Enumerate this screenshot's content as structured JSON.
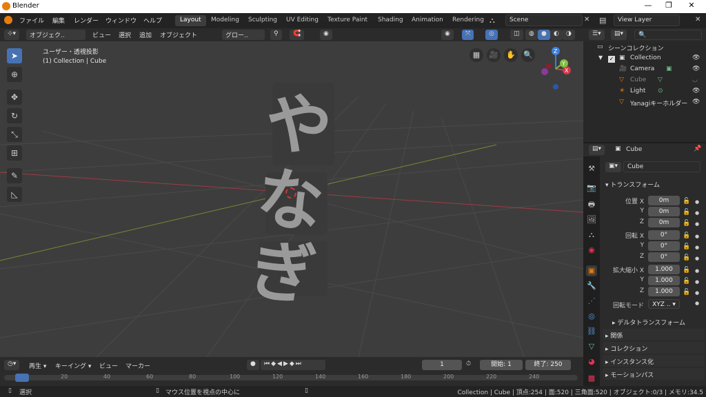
{
  "window": {
    "title": "Blender"
  },
  "menu": [
    "ファイル",
    "編集",
    "レンダー",
    "ウィンドウ",
    "ヘルプ"
  ],
  "workspaces": [
    "Layout",
    "Modeling",
    "Sculpting",
    "UV Editing",
    "Texture Paint",
    "Shading",
    "Animation",
    "Rendering"
  ],
  "scene": "Scene",
  "view_layer": "View Layer",
  "viewport_header": {
    "mode": "オブジェク..",
    "view": "ビュー",
    "select": "選択",
    "add": "追加",
    "object": "オブジェクト",
    "orientation": "グロー.."
  },
  "viewport": {
    "view_name": "ユーザー・透視投影",
    "collection_info": "(1) Collection | Cube",
    "mesh_text": "やなぎ",
    "gizmo": {
      "x": "X",
      "y": "Y",
      "z": "Z"
    }
  },
  "outliner": {
    "scene_collection": "シーンコレクション",
    "items": [
      {
        "name": "Collection"
      },
      {
        "name": "Camera"
      },
      {
        "name": "Cube"
      },
      {
        "name": "Light"
      },
      {
        "name": "Yanagiキーホルダー"
      }
    ]
  },
  "properties": {
    "object_name": "Cube",
    "datablock": "Cube",
    "transform": "トランスフォーム",
    "location_label": "位置",
    "rotation_label": "回転",
    "scale_label": "拡大縮小",
    "axes": [
      "X",
      "Y",
      "Z"
    ],
    "location": [
      "0m",
      "0m",
      "0m"
    ],
    "rotation": [
      "0°",
      "0°",
      "0°"
    ],
    "scale": [
      "1.000",
      "1.000",
      "1.000"
    ],
    "rotation_mode_label": "回転モード",
    "rotation_mode": "XYZ ..",
    "delta": "デルタトランスフォーム",
    "relations": "関係",
    "collections": "コレクション",
    "instancing": "インスタンス化",
    "motion_paths": "モーションパス"
  },
  "timeline": {
    "playback": "再生",
    "keying": "キーイング",
    "view": "ビュー",
    "marker": "マーカー",
    "current_frame": "1",
    "start_label": "開始:",
    "start": "1",
    "end_label": "終了:",
    "end": "250",
    "ruler": [
      "20",
      "40",
      "60",
      "80",
      "100",
      "120",
      "140",
      "160",
      "180",
      "200",
      "220",
      "240"
    ]
  },
  "status": {
    "select": "選択",
    "center": "マウス位置を視点の中心に",
    "stats": "Collection | Cube | 頂点:254 | 面:520 | 三角面:520 | オブジェクト:0/3 | メモリ:34.5"
  },
  "colors": {
    "accent": "#4772b3",
    "orange": "#e87d0d",
    "x_axis": "#d3394b",
    "y_axis": "#7fbf3f",
    "z_axis": "#3b7fdd"
  }
}
